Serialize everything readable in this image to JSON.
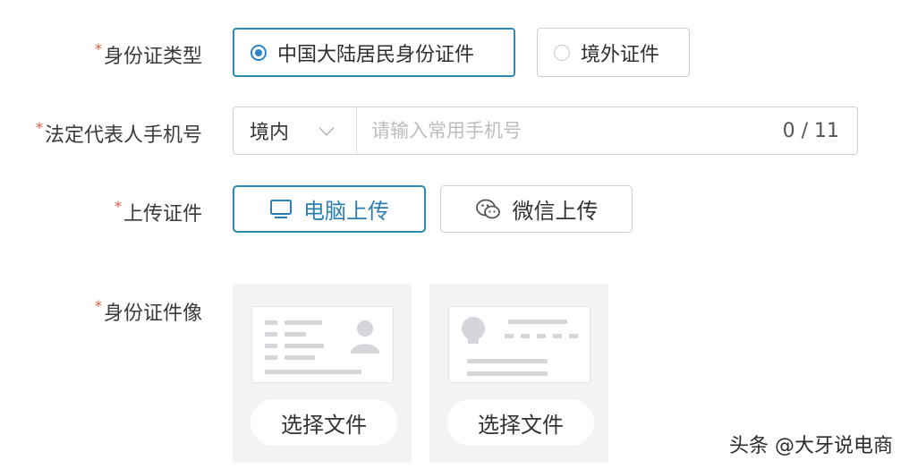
{
  "required_mark": "*",
  "id_type": {
    "label": "身份证类型",
    "options": [
      {
        "label": "中国大陆居民身份证件",
        "selected": true
      },
      {
        "label": "境外证件",
        "selected": false
      }
    ]
  },
  "phone": {
    "label": "法定代表人手机号",
    "region": "境内",
    "placeholder": "请输入常用手机号",
    "value": "",
    "counter": "0 / 11"
  },
  "upload": {
    "label": "上传证件",
    "pc_label": "电脑上传",
    "wechat_label": "微信上传",
    "active": "pc"
  },
  "id_image": {
    "label": "身份证件像",
    "tiles": [
      {
        "side": "portrait",
        "button": "选择文件"
      },
      {
        "side": "emblem",
        "button": "选择文件"
      }
    ]
  },
  "watermark": "头条 @大牙说电商",
  "colors": {
    "accent": "#2d8ab3",
    "required": "#e5533a",
    "tile_bg": "#f2f3f5"
  }
}
